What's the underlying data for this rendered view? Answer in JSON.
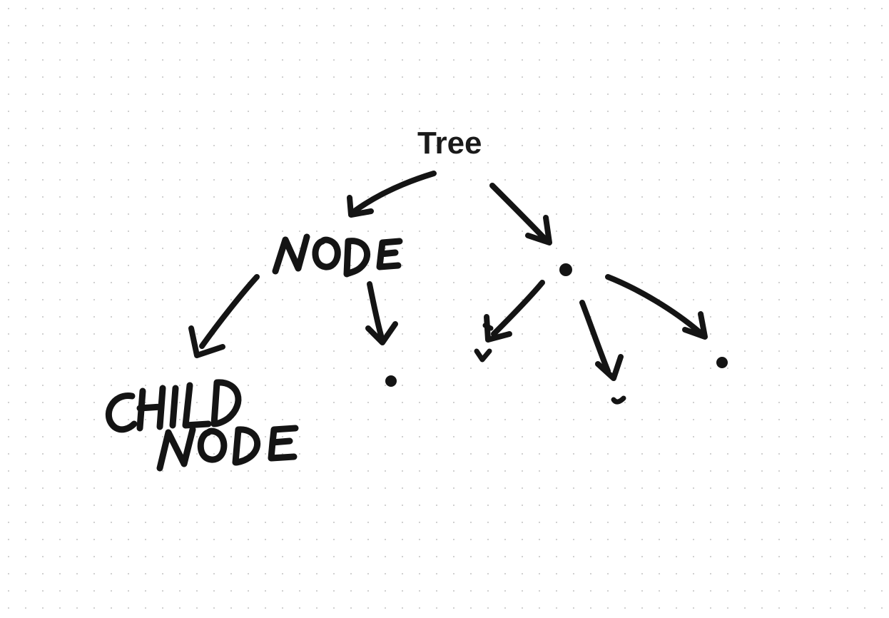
{
  "diagram": {
    "title": "Tree",
    "root_label": "Tree",
    "handwritten": {
      "node_label": "NODE",
      "child_node_label_line1": "CHILD",
      "child_node_label_line2": "NODE"
    },
    "strokeColor": "#141414",
    "strokeWidth": 7,
    "dotGrid": {
      "spacing": 24,
      "dotColor": "#d0d0d0"
    },
    "structure": {
      "root": "Tree",
      "children": [
        {
          "label": "NODE",
          "children": [
            {
              "label": "CHILD NODE"
            },
            {
              "label": "dot"
            }
          ]
        },
        {
          "label": "dot",
          "children": [
            {
              "label": "dot"
            },
            {
              "label": "dot"
            },
            {
              "label": "dot"
            }
          ]
        }
      ]
    }
  }
}
